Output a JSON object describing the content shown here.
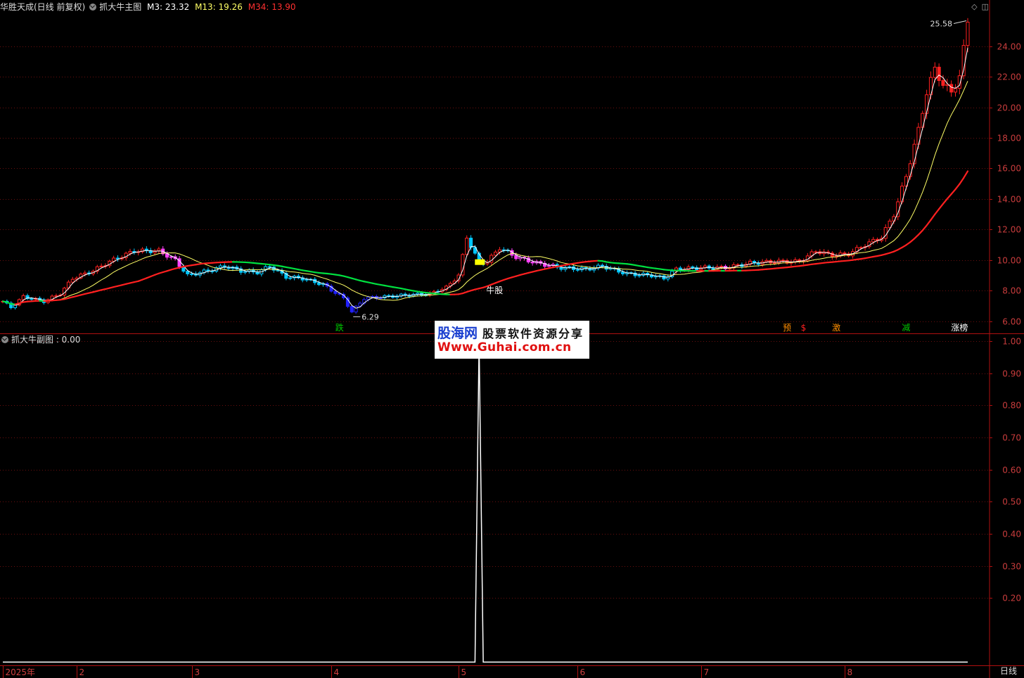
{
  "header": {
    "stock_name": "华胜天成(日线 前复权)",
    "indicator_name": "抓大牛主图",
    "m3_label": "M3: 23.32",
    "m13_label": "M13: 19.26",
    "m34_label": "M34: 13.90",
    "sub_indicator": "抓大牛副图 : 0.00"
  },
  "colors": {
    "up": "#ff2020",
    "down": "#00c8ff",
    "magenta": "#ff40ff",
    "blue": "#2020ff",
    "m3": "#ffffff",
    "m13": "#ffff66",
    "m34_up": "#ff2020",
    "m34_down": "#00e040",
    "axis": "#b01010"
  },
  "annotations": {
    "high_label": "25.58",
    "low_label": "6.29",
    "bull_label": "牛股"
  },
  "signals": [
    {
      "label": "跌",
      "color": "#00c800",
      "day": 82
    },
    {
      "label": "预",
      "color": "#ff8c00",
      "day": 191
    },
    {
      "label": "$",
      "color": "#ff2020",
      "day": 195
    },
    {
      "label": "激",
      "color": "#ff8c00",
      "day": 203
    },
    {
      "label": "减",
      "color": "#00c800",
      "day": 220
    },
    {
      "label": "涨榜",
      "color": "#ffffff",
      "day": 233
    }
  ],
  "watermark": {
    "brand": "股海网",
    "subtitle": "股票软件资源分享",
    "url": "Www.Guhai.com.cn"
  },
  "bottom_tab": "日线",
  "chart_data": [
    {
      "type": "candlestick",
      "title": "抓大牛主图",
      "y_ticks": [
        "6.00",
        "8.00",
        "10.00",
        "12.00",
        "14.00",
        "16.00",
        "18.00",
        "20.00",
        "22.00",
        "24.00"
      ],
      "ylim": [
        5.2,
        26.2
      ],
      "x_month_labels": [
        {
          "label": "2025年",
          "day": 0
        },
        {
          "label": "2",
          "day": 18
        },
        {
          "label": "3",
          "day": 46
        },
        {
          "label": "4",
          "day": 80
        },
        {
          "label": "5",
          "day": 111
        },
        {
          "label": "6",
          "day": 140
        },
        {
          "label": "7",
          "day": 170
        },
        {
          "label": "8",
          "day": 205
        }
      ],
      "waypoints": [
        {
          "day": 0,
          "close": 7.3
        },
        {
          "day": 2,
          "close": 6.9
        },
        {
          "day": 5,
          "close": 7.6
        },
        {
          "day": 10,
          "close": 7.3
        },
        {
          "day": 14,
          "close": 7.8
        },
        {
          "day": 17,
          "close": 8.8
        },
        {
          "day": 22,
          "close": 9.3
        },
        {
          "day": 26,
          "close": 9.9
        },
        {
          "day": 32,
          "close": 10.6
        },
        {
          "day": 38,
          "close": 10.6
        },
        {
          "day": 42,
          "close": 10.0
        },
        {
          "day": 45,
          "close": 9.0
        },
        {
          "day": 50,
          "close": 9.3
        },
        {
          "day": 54,
          "close": 9.6
        },
        {
          "day": 58,
          "close": 9.3
        },
        {
          "day": 62,
          "close": 9.2
        },
        {
          "day": 65,
          "close": 9.6
        },
        {
          "day": 69,
          "close": 8.9
        },
        {
          "day": 73,
          "close": 8.8
        },
        {
          "day": 78,
          "close": 8.4
        },
        {
          "day": 83,
          "close": 7.5
        },
        {
          "day": 85,
          "close": 6.6
        },
        {
          "day": 88,
          "close": 7.5
        },
        {
          "day": 93,
          "close": 7.6
        },
        {
          "day": 98,
          "close": 7.7
        },
        {
          "day": 104,
          "close": 7.8
        },
        {
          "day": 108,
          "close": 8.2
        },
        {
          "day": 111,
          "close": 9.0
        },
        {
          "day": 113,
          "close": 11.5
        },
        {
          "day": 116,
          "close": 9.8
        },
        {
          "day": 118,
          "close": 9.9
        },
        {
          "day": 121,
          "close": 10.8
        },
        {
          "day": 125,
          "close": 10.2
        },
        {
          "day": 130,
          "close": 9.8
        },
        {
          "day": 136,
          "close": 9.5
        },
        {
          "day": 142,
          "close": 9.4
        },
        {
          "day": 146,
          "close": 9.6
        },
        {
          "day": 152,
          "close": 9.1
        },
        {
          "day": 158,
          "close": 9.0
        },
        {
          "day": 161,
          "close": 8.8
        },
        {
          "day": 164,
          "close": 9.4
        },
        {
          "day": 170,
          "close": 9.5
        },
        {
          "day": 176,
          "close": 9.5
        },
        {
          "day": 182,
          "close": 9.8
        },
        {
          "day": 188,
          "close": 9.9
        },
        {
          "day": 194,
          "close": 9.9
        },
        {
          "day": 198,
          "close": 10.6
        },
        {
          "day": 202,
          "close": 10.3
        },
        {
          "day": 206,
          "close": 10.4
        },
        {
          "day": 210,
          "close": 11.0
        },
        {
          "day": 214,
          "close": 11.5
        },
        {
          "day": 217,
          "close": 13.0
        },
        {
          "day": 220,
          "close": 15.5
        },
        {
          "day": 223,
          "close": 18.5
        },
        {
          "day": 225,
          "close": 21.0
        },
        {
          "day": 227,
          "close": 22.5
        },
        {
          "day": 229,
          "close": 21.5
        },
        {
          "day": 231,
          "close": 21.0
        },
        {
          "day": 233,
          "close": 22.0
        },
        {
          "day": 235,
          "close": 25.58
        }
      ],
      "total_days": 236
    },
    {
      "type": "line",
      "title": "抓大牛副图",
      "y_ticks": [
        "0.20",
        "0.30",
        "0.40",
        "0.50",
        "0.60",
        "0.70",
        "0.80",
        "0.90",
        "1.00"
      ],
      "ylim": [
        -0.01,
        1.02
      ],
      "spike_days": [
        116
      ],
      "spike_value": 1.0,
      "base_value": 0.0
    }
  ]
}
